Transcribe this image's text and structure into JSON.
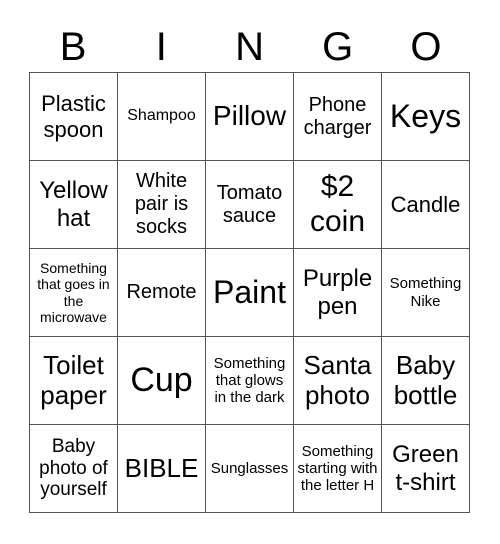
{
  "header": [
    "B",
    "I",
    "N",
    "G",
    "O"
  ],
  "cells": [
    {
      "text": "Plastic spoon",
      "size": 22
    },
    {
      "text": "Shampoo",
      "size": 16
    },
    {
      "text": "Pillow",
      "size": 28
    },
    {
      "text": "Phone charger",
      "size": 20
    },
    {
      "text": "Keys",
      "size": 32
    },
    {
      "text": "Yellow hat",
      "size": 24
    },
    {
      "text": "White pair is socks",
      "size": 20
    },
    {
      "text": "Tomato sauce",
      "size": 20
    },
    {
      "text": "$2 coin",
      "size": 30
    },
    {
      "text": "Candle",
      "size": 22
    },
    {
      "text": "Something that goes in the microwave",
      "size": 14
    },
    {
      "text": "Remote",
      "size": 20
    },
    {
      "text": "Paint",
      "size": 32
    },
    {
      "text": "Purple pen",
      "size": 24
    },
    {
      "text": "Something Nike",
      "size": 15
    },
    {
      "text": "Toilet paper",
      "size": 26
    },
    {
      "text": "Cup",
      "size": 34
    },
    {
      "text": "Something that glows in the dark",
      "size": 15
    },
    {
      "text": "Santa photo",
      "size": 26
    },
    {
      "text": "Baby bottle",
      "size": 26
    },
    {
      "text": "Baby photo of yourself",
      "size": 19
    },
    {
      "text": "BIBLE",
      "size": 26
    },
    {
      "text": "Sunglasses",
      "size": 15
    },
    {
      "text": "Something starting with the letter H",
      "size": 15
    },
    {
      "text": "Green t-shirt",
      "size": 24
    }
  ]
}
